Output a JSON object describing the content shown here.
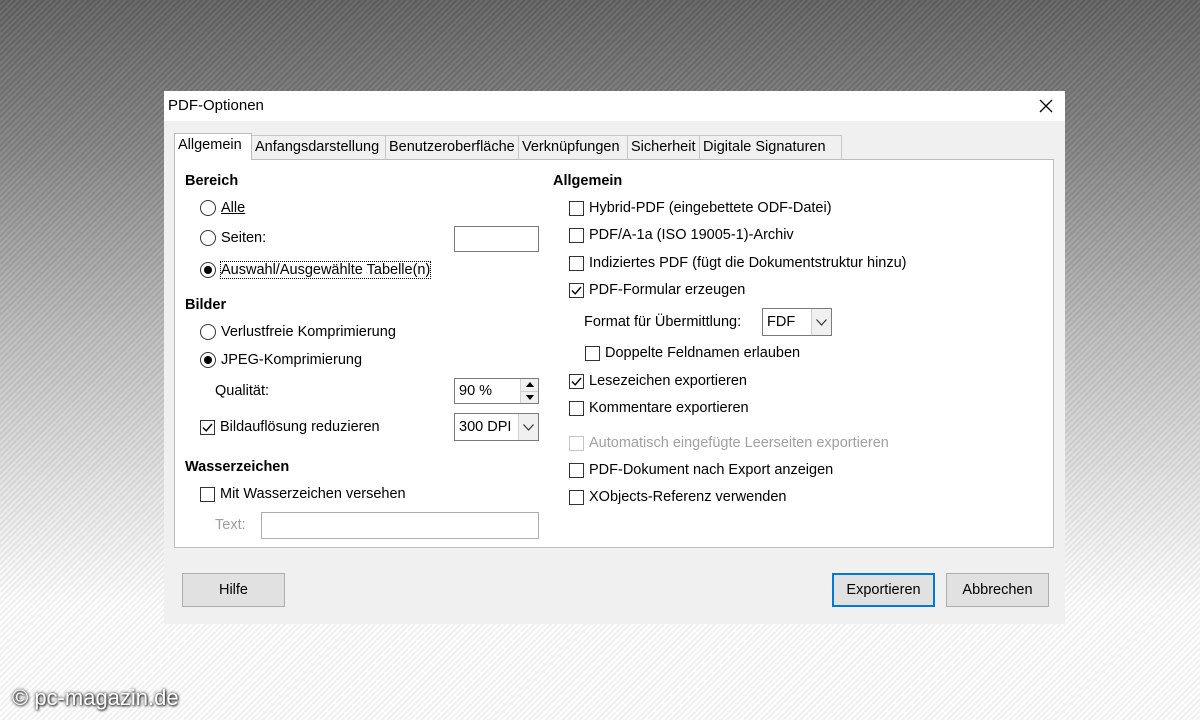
{
  "dialog": {
    "title": "PDF-Optionen",
    "close_icon": "close-icon"
  },
  "tabs": [
    {
      "label": "Allgemein",
      "active": true
    },
    {
      "label": "Anfangsdarstellung",
      "active": false
    },
    {
      "label": "Benutzeroberfläche",
      "active": false
    },
    {
      "label": "Verknüpfungen",
      "active": false
    },
    {
      "label": "Sicherheit",
      "active": false
    },
    {
      "label": "Digitale Signaturen",
      "active": false
    }
  ],
  "bereich": {
    "heading": "Bereich",
    "alle": {
      "label": "Alle",
      "selected": false
    },
    "seiten": {
      "label": "Seiten:",
      "selected": false,
      "value": ""
    },
    "auswahl": {
      "label": "Auswahl/Ausgewählte Tabelle(n)",
      "selected": true
    }
  },
  "bilder": {
    "heading": "Bilder",
    "verlustfrei": {
      "label": "Verlustfreie Komprimierung",
      "selected": false
    },
    "jpeg": {
      "label": "JPEG-Komprimierung",
      "selected": true
    },
    "qualitaet_label": "Qualität:",
    "qualitaet_value": "90 %",
    "aufloesung": {
      "label": "Bildauflösung reduzieren",
      "checked": true
    },
    "dpi_value": "300 DPI"
  },
  "wasserzeichen": {
    "heading": "Wasserzeichen",
    "mit": {
      "label": "Mit Wasserzeichen versehen",
      "checked": false
    },
    "text_label": "Text:",
    "text_value": ""
  },
  "allgemein": {
    "heading": "Allgemein",
    "hybrid": {
      "label": "Hybrid-PDF (eingebettete ODF-Datei)",
      "checked": false
    },
    "pdfa": {
      "label": "PDF/A-1a (ISO 19005-1)-Archiv",
      "checked": false
    },
    "indiziert": {
      "label": "Indiziertes PDF (fügt die Dokumentstruktur hinzu)",
      "checked": false
    },
    "formular": {
      "label": "PDF-Formular erzeugen",
      "checked": true
    },
    "format_label": "Format für Übermittlung:",
    "format_value": "FDF",
    "doppelte": {
      "label": "Doppelte Feldnamen erlauben",
      "checked": false
    },
    "lesezeichen": {
      "label": "Lesezeichen exportieren",
      "checked": true
    },
    "kommentare": {
      "label": "Kommentare exportieren",
      "checked": false
    },
    "leerseiten": {
      "label": "Automatisch eingefügte Leerseiten exportieren",
      "checked": false,
      "disabled": true
    },
    "anzeigen": {
      "label": "PDF-Dokument nach Export anzeigen",
      "checked": false
    },
    "xobjects": {
      "label": "XObjects-Referenz verwenden",
      "checked": false
    }
  },
  "buttons": {
    "hilfe": "Hilfe",
    "exportieren": "Exportieren",
    "abbrechen": "Abbrechen"
  },
  "watermark": "© pc-magazin.de",
  "colors": {
    "accent": "#0078d7",
    "dialog_bg": "#f0f0f0",
    "panel_bg": "#ffffff"
  }
}
